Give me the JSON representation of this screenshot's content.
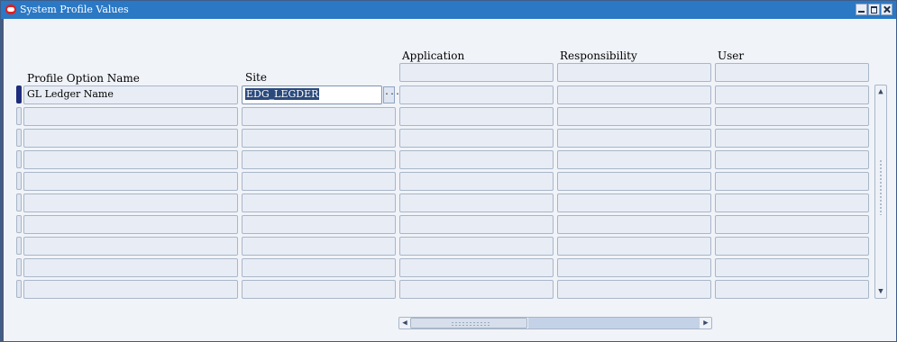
{
  "window": {
    "title": "System Profile Values",
    "app_icon": "oracle-icon",
    "controls": [
      "minimize-icon",
      "maximize-icon",
      "close-icon"
    ]
  },
  "columns": {
    "profile_option_name": "Profile Option Name",
    "site": "Site",
    "application": "Application",
    "responsibility": "Responsibility",
    "user": "User"
  },
  "rows": [
    {
      "profile_option_name": "GL Ledger Name",
      "site": "EDG_LEGDER",
      "application": "",
      "responsibility": "",
      "user": ""
    },
    {
      "profile_option_name": "",
      "site": "",
      "application": "",
      "responsibility": "",
      "user": ""
    },
    {
      "profile_option_name": "",
      "site": "",
      "application": "",
      "responsibility": "",
      "user": ""
    },
    {
      "profile_option_name": "",
      "site": "",
      "application": "",
      "responsibility": "",
      "user": ""
    },
    {
      "profile_option_name": "",
      "site": "",
      "application": "",
      "responsibility": "",
      "user": ""
    },
    {
      "profile_option_name": "",
      "site": "",
      "application": "",
      "responsibility": "",
      "user": ""
    },
    {
      "profile_option_name": "",
      "site": "",
      "application": "",
      "responsibility": "",
      "user": ""
    },
    {
      "profile_option_name": "",
      "site": "",
      "application": "",
      "responsibility": "",
      "user": ""
    },
    {
      "profile_option_name": "",
      "site": "",
      "application": "",
      "responsibility": "",
      "user": ""
    },
    {
      "profile_option_name": "",
      "site": "",
      "application": "",
      "responsibility": "",
      "user": ""
    }
  ],
  "active_field": {
    "row": 0,
    "column": "site",
    "lov_button": "ellipsis-icon",
    "lov_label": "..."
  },
  "scrollbars": {
    "vertical": "visible",
    "horizontal": "visible"
  },
  "colors": {
    "titlebar": "#2b78c4",
    "selection": "#2b4a7c",
    "field_bg": "#e8edf5"
  }
}
